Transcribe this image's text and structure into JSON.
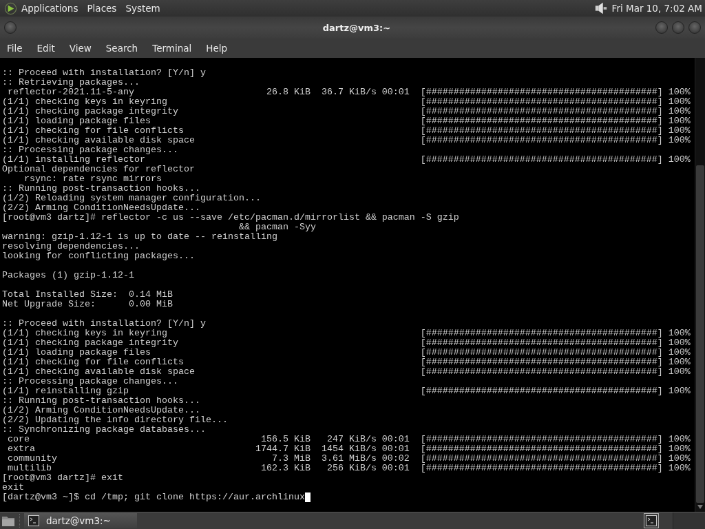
{
  "top_panel": {
    "menus": [
      "Applications",
      "Places",
      "System"
    ],
    "clock": "Fri Mar 10,  7:02 AM"
  },
  "window": {
    "title": "dartz@vm3:~"
  },
  "menu_bar": [
    "File",
    "Edit",
    "View",
    "Search",
    "Terminal",
    "Help"
  ],
  "terminal": {
    "cursor_visible": true,
    "blocks": [
      [
        ":: Proceed with installation? [Y/n] y",
        ":: Retrieving packages...",
        " reflector-2021.11-5-any                        26.8 KiB  36.7 KiB/s 00:01  [##########################################] 100%",
        "(1/1) checking keys in keyring                                              [##########################################] 100%",
        "(1/1) checking package integrity                                            [##########################################] 100%",
        "(1/1) loading package files                                                 [##########################################] 100%",
        "(1/1) checking for file conflicts                                           [##########################################] 100%",
        "(1/1) checking available disk space                                         [##########################################] 100%",
        ":: Processing package changes...",
        "(1/1) installing reflector                                                  [##########################################] 100%",
        "Optional dependencies for reflector",
        "    rsync: rate rsync mirrors",
        ":: Running post-transaction hooks...",
        "(1/2) Reloading system manager configuration...",
        "(2/2) Arming ConditionNeedsUpdate...",
        "[root@vm3 dartz]# reflector -c us --save /etc/pacman.d/mirrorlist && pacman -S gzip",
        "                                           && pacman -Syy",
        "warning: gzip-1.12-1 is up to date -- reinstalling",
        "resolving dependencies...",
        "looking for conflicting packages..."
      ],
      [
        "Packages (1) gzip-1.12-1"
      ],
      [
        "Total Installed Size:  0.14 MiB",
        "Net Upgrade Size:      0.00 MiB"
      ],
      [
        ":: Proceed with installation? [Y/n] y",
        "(1/1) checking keys in keyring                                              [##########################################] 100%",
        "(1/1) checking package integrity                                            [##########################################] 100%",
        "(1/1) loading package files                                                 [##########################################] 100%",
        "(1/1) checking for file conflicts                                           [##########################################] 100%",
        "(1/1) checking available disk space                                         [##########################################] 100%",
        ":: Processing package changes...",
        "(1/1) reinstalling gzip                                                     [##########################################] 100%",
        ":: Running post-transaction hooks...",
        "(1/2) Arming ConditionNeedsUpdate...",
        "(2/2) Updating the info directory file...",
        ":: Synchronizing package databases...",
        " core                                          156.5 KiB   247 KiB/s 00:01  [##########################################] 100%",
        " extra                                        1744.7 KiB  1454 KiB/s 00:01  [##########################################] 100%",
        " community                                       7.3 MiB  3.61 MiB/s 00:02  [##########################################] 100%",
        " multilib                                      162.3 KiB   256 KiB/s 00:01  [##########################################] 100%",
        "[root@vm3 dartz]# exit",
        "exit",
        "[dartz@vm3 ~]$ cd /tmp; git clone https://aur.archlinux"
      ]
    ]
  },
  "taskbar": {
    "tasks": [
      {
        "label": "dartz@vm3:~",
        "selected": true
      }
    ]
  }
}
